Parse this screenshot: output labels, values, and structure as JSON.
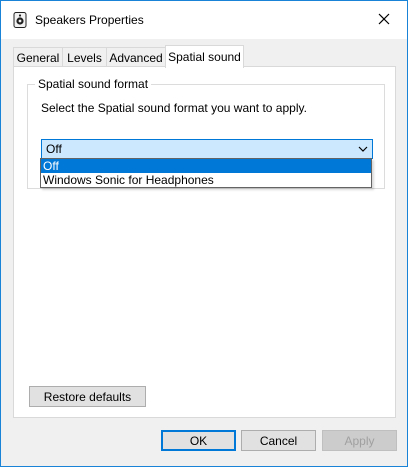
{
  "window": {
    "title": "Speakers Properties",
    "accent": "#0078d7",
    "border_color": "#1883d7"
  },
  "icons": {
    "app": "speaker-icon",
    "close": "close-icon",
    "combo_arrow": "chevron-down-icon"
  },
  "tabs": [
    {
      "label": "General",
      "active": false
    },
    {
      "label": "Levels",
      "active": false
    },
    {
      "label": "Advanced",
      "active": false
    },
    {
      "label": "Spatial sound",
      "active": true
    }
  ],
  "spatial": {
    "group_label": "Spatial sound format",
    "instruction": "Select the Spatial sound format you want to apply.",
    "selected": "Off",
    "options": [
      "Off",
      "Windows Sonic for Headphones"
    ]
  },
  "buttons": {
    "restore": "Restore defaults",
    "ok": "OK",
    "cancel": "Cancel",
    "apply": "Apply"
  }
}
